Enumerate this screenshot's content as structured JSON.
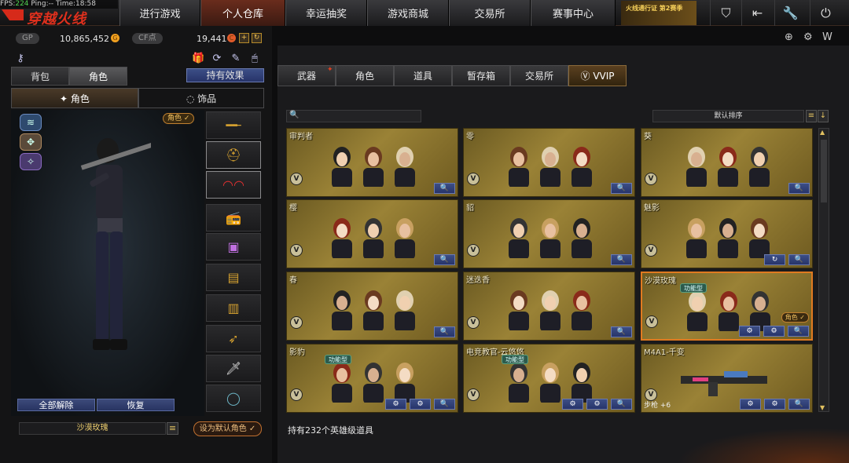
{
  "hud": {
    "fps_label": "FPS:",
    "fps_value": "224",
    "ping_label": "Ping:",
    "ping_value": "--",
    "time_label": "Time:",
    "time_value": "18:58"
  },
  "logo_text": "穿越火线",
  "nav": [
    {
      "label": "进行游戏"
    },
    {
      "label": "个人仓库",
      "active": true
    },
    {
      "label": "幸运抽奖"
    },
    {
      "label": "游戏商城"
    },
    {
      "label": "交易所"
    },
    {
      "label": "赛事中心"
    }
  ],
  "promo_text": "火线通行证 第2赛季",
  "top_icons": [
    "shield-icon",
    "logout-icon",
    "wrench-icon",
    "power-icon"
  ],
  "currency": {
    "gp_label": "GP",
    "gp_value": "10,865,452",
    "cf_label": "CF点",
    "cf_value": "19,441"
  },
  "left_tabs": [
    {
      "label": "背包"
    },
    {
      "label": "角色",
      "active": true
    }
  ],
  "effects_button": "持有效果",
  "sub_tabs": [
    {
      "label": "角色",
      "active": true
    },
    {
      "label": "饰品"
    }
  ],
  "role_badge": "角色 ✓",
  "slots": [
    "sniper-rifle-icon",
    "helmet-icon",
    "goggles-icon",
    "radio-icon",
    "box-icon",
    "backpack-icon",
    "ammo-icon",
    "bullet-icon",
    "knife-icon",
    "ring-icon"
  ],
  "unequip_button": "全部解除",
  "restore_button": "恢复",
  "current_character": "沙漠玫瑰",
  "set_default_button": "设为默认角色 ✓",
  "right_tabs": [
    {
      "label": "武器"
    },
    {
      "label": "角色"
    },
    {
      "label": "道具"
    },
    {
      "label": "暂存箱"
    },
    {
      "label": "交易所"
    },
    {
      "label": "VVIP",
      "active": true
    }
  ],
  "sort_label": "默认排序",
  "cards": [
    {
      "title": "审判者"
    },
    {
      "title": "零"
    },
    {
      "title": "葵"
    },
    {
      "title": "樱"
    },
    {
      "title": "貂"
    },
    {
      "title": "魅影"
    },
    {
      "title": "春"
    },
    {
      "title": "迷迭香"
    },
    {
      "title": "沙漠玫瑰",
      "functional": "功能型",
      "badge": "角色 ✓",
      "selected": true
    },
    {
      "title": "影豹",
      "functional": "功能型"
    },
    {
      "title": "电竞教官-云悠悠",
      "functional": "功能型"
    },
    {
      "title": "M4A1-千变",
      "extra": "步枪 +6"
    }
  ],
  "footer_text": "持有232个英雄级道具",
  "colors": {
    "accent_orange": "#e07a20",
    "card_gold": "#9a8236",
    "button_blue": "#3c4e86"
  }
}
